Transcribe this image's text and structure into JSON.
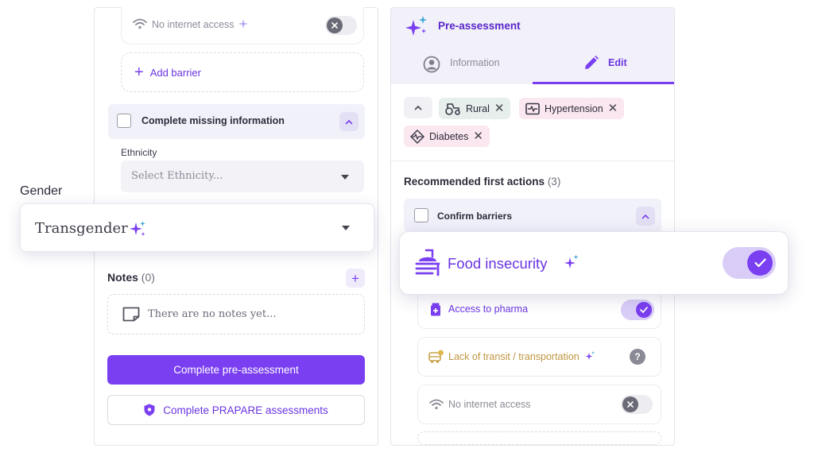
{
  "left": {
    "barrier_item": {
      "label": "No internet access",
      "toggle_on": false
    },
    "add_barrier_label": "Add barrier",
    "complete_missing": {
      "title": "Complete missing information"
    },
    "ethnicity": {
      "label": "Ethnicity",
      "placeholder": "Select Ethnicity..."
    },
    "gender": {
      "label": "Gender",
      "value": "Transgender"
    },
    "notes": {
      "title": "Notes",
      "count": "(0)",
      "empty_text": "There are no notes yet..."
    },
    "primary_button": "Complete pre-assessment",
    "secondary_button": "Complete PRAPARE assessments"
  },
  "right": {
    "title": "Pre-assessment",
    "tabs": [
      {
        "label": "Information",
        "active": false
      },
      {
        "label": "Edit",
        "active": true
      }
    ],
    "chips": [
      {
        "label": "Rural",
        "icon": "tractor-icon",
        "color": "green"
      },
      {
        "label": "Hypertension",
        "icon": "heart-monitor-icon",
        "color": "pink"
      },
      {
        "label": "Diabetes",
        "icon": "pulse-icon",
        "color": "pink"
      }
    ],
    "recommended": {
      "title": "Recommended first actions",
      "count": "(3)"
    },
    "confirm_barriers": {
      "title": "Confirm barriers"
    },
    "barriers": [
      {
        "label": "Food insecurity",
        "toggle_on": true,
        "color": "#6a35e0"
      },
      {
        "label": "Access to pharma",
        "toggle_on": true,
        "color": "#6a35e0"
      },
      {
        "label": "Lack of transit / transportation",
        "toggle_on": null,
        "color": "#c9a24a"
      },
      {
        "label": "No internet access",
        "toggle_on": false,
        "color": "#8a8a96"
      }
    ]
  },
  "colors": {
    "accent": "#7a3ff0",
    "accent_dark": "#5a25c9",
    "chip_green": "#e6efec",
    "chip_pink": "#fbe7ef"
  }
}
